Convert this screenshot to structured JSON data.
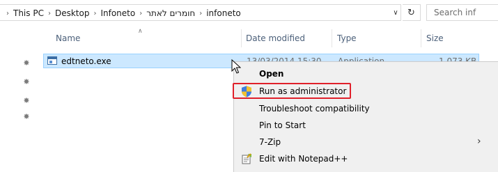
{
  "address_bar": {
    "breadcrumbs": [
      "This PC",
      "Desktop",
      "Infoneto",
      "חומרים לאתר",
      "infoneto"
    ],
    "refresh_icon": "refresh-icon",
    "dropdown_icon": "chevron-down-icon",
    "search_placeholder": "Search inf"
  },
  "columns": {
    "name": "Name",
    "date_modified": "Date modified",
    "type": "Type",
    "size": "Size",
    "sort_icon": "sort-ascending-icon"
  },
  "files": [
    {
      "name": "edtneto.exe",
      "date_modified": "13/03/2014 15:30",
      "type": "Application",
      "size": "1,073 KB",
      "icon": "exe-file-icon",
      "selected": true
    }
  ],
  "context_menu": {
    "items": [
      {
        "label": "Open",
        "bold": true
      },
      {
        "label": "Run as administrator",
        "icon": "uac-shield-icon",
        "highlighted": true
      },
      {
        "label": "Troubleshoot compatibility"
      },
      {
        "label": "Pin to Start"
      },
      {
        "label": "7-Zip",
        "submenu": true
      },
      {
        "label": "Edit with Notepad++",
        "icon": "notepad-plus-plus-icon"
      }
    ],
    "highlight_color": "#e0202a"
  },
  "colors": {
    "selection_bg": "#cce8ff",
    "selection_border": "#99d1ff",
    "header_text": "#4c607a",
    "menu_bg": "#f0f0f0"
  }
}
